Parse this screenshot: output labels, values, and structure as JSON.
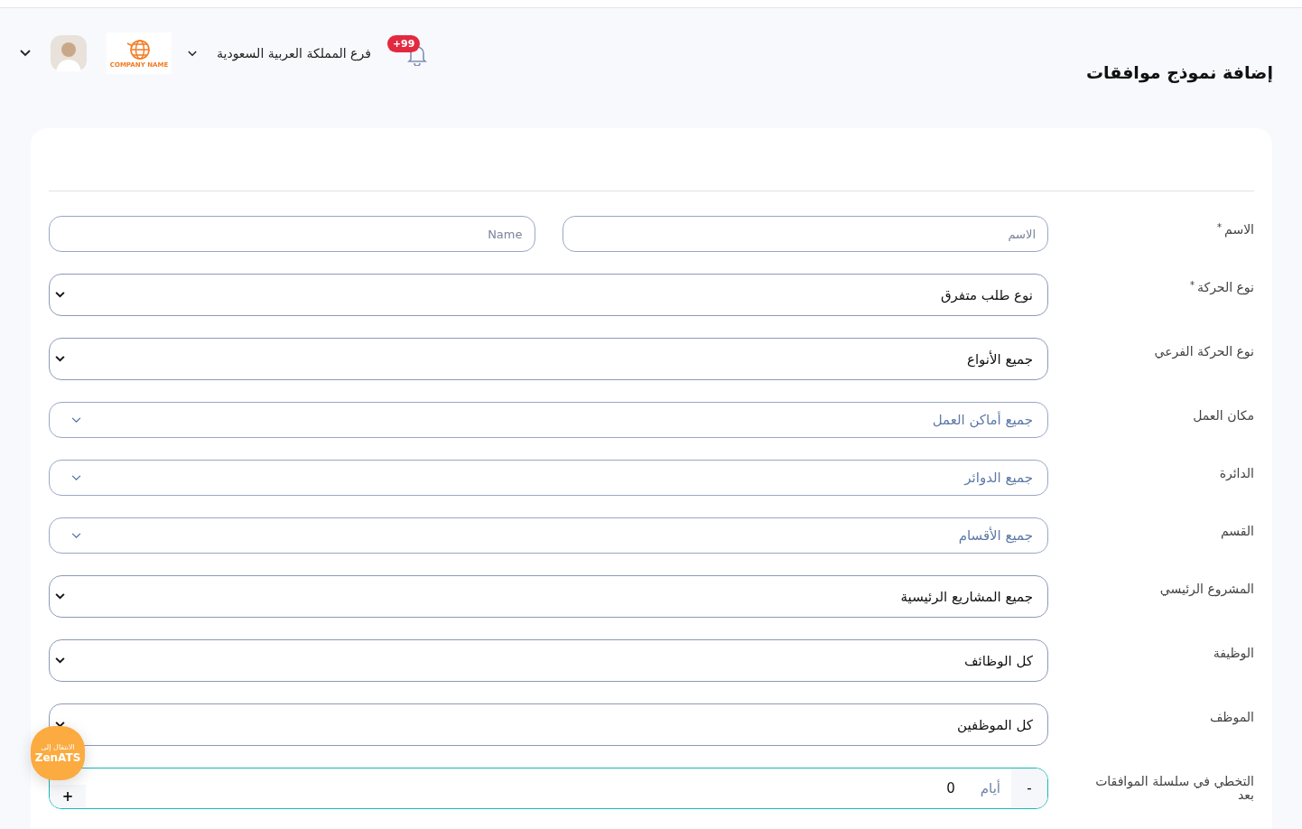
{
  "header": {
    "title": "إضافة نموذج موافقات",
    "notification_badge": "+99",
    "branch": "فرع المملكة العربية السعودية",
    "company_logo_text": "COMPANY NAME"
  },
  "form": {
    "rows": [
      {
        "kind": "text-pair",
        "label": "الاسم",
        "required_mark": "*",
        "fields": [
          {
            "placeholder": "الاسم"
          },
          {
            "placeholder": "Name"
          }
        ]
      },
      {
        "kind": "select",
        "label": "نوع الحركة",
        "required_mark": "*",
        "value": "نوع طلب متفرق"
      },
      {
        "kind": "select",
        "label": "نوع الحركة الفرعي",
        "value": "جميع الأنواع"
      },
      {
        "kind": "picker",
        "label": "مكان العمل",
        "placeholder": "جميع أماكن العمل"
      },
      {
        "kind": "picker",
        "label": "الدائرة",
        "placeholder": "جميع الدوائر"
      },
      {
        "kind": "picker",
        "label": "القسم",
        "placeholder": "جميع الأقسام"
      },
      {
        "kind": "select",
        "label": "المشروع الرئيسي",
        "value": "جميع المشاريع الرئيسية"
      },
      {
        "kind": "select",
        "label": "الوظيفة",
        "value": "كل الوظائف"
      },
      {
        "kind": "select",
        "label": "الموظف",
        "value": "كل الموظفين"
      },
      {
        "kind": "stepper",
        "label": "التخطي في سلسلة الموافقات بعد",
        "decrement": "-",
        "unit": "أيام",
        "value": "0",
        "increment": "+"
      }
    ]
  },
  "floating_button": {
    "line1": "الانتقال إلى",
    "line2": "ZenATS"
  }
}
